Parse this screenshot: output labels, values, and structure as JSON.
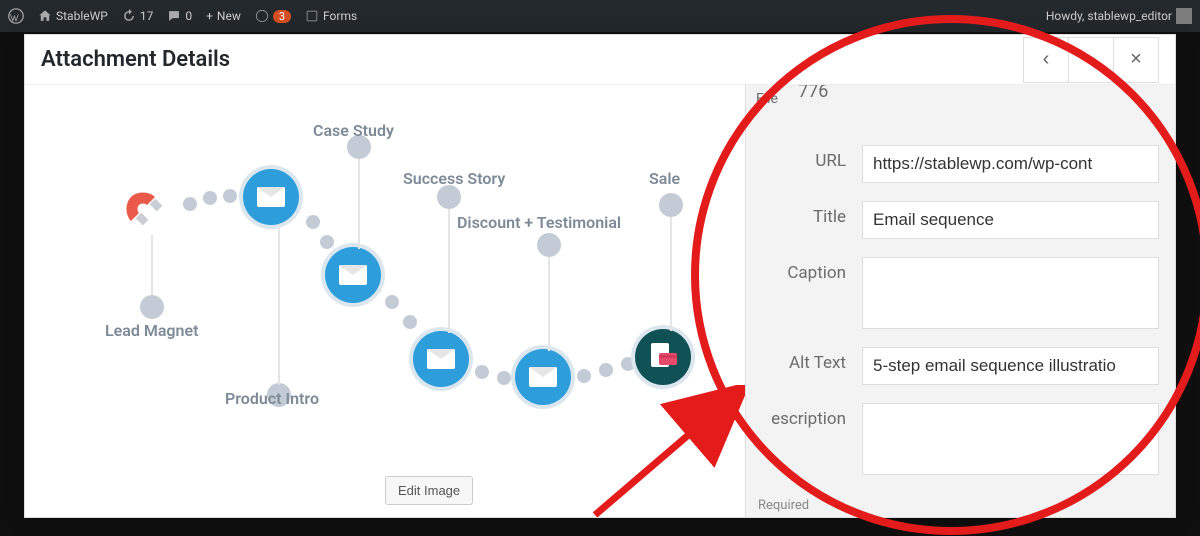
{
  "adminbar": {
    "site_name": "StableWP",
    "updates": "17",
    "comments": "0",
    "new": "New",
    "notif_count": "3",
    "forms": "Forms",
    "howdy": "Howdy, stablewp_editor"
  },
  "modal": {
    "title": "Attachment Details",
    "nav_prev": "‹",
    "nav_next": "›",
    "nav_close": "×",
    "edit_image": "Edit Image"
  },
  "sequence": {
    "lead_magnet": "Lead Magnet",
    "case_study": "Case Study",
    "product_intro": "Product Intro",
    "success_story": "Success Story",
    "discount_testimonial": "Discount + Testimonial",
    "sale": "Sale"
  },
  "details": {
    "meta_776": "776",
    "file_label": "File",
    "url_label": "URL",
    "url_value": "https://stablewp.com/wp-cont",
    "title_label": "Title",
    "title_value": "Email sequence",
    "caption_label": "Caption",
    "caption_value": "",
    "alt_label": "Alt Text",
    "alt_value": "5-step email sequence illustratio",
    "desc_label": "escription",
    "desc_value": "",
    "required": "Required"
  }
}
